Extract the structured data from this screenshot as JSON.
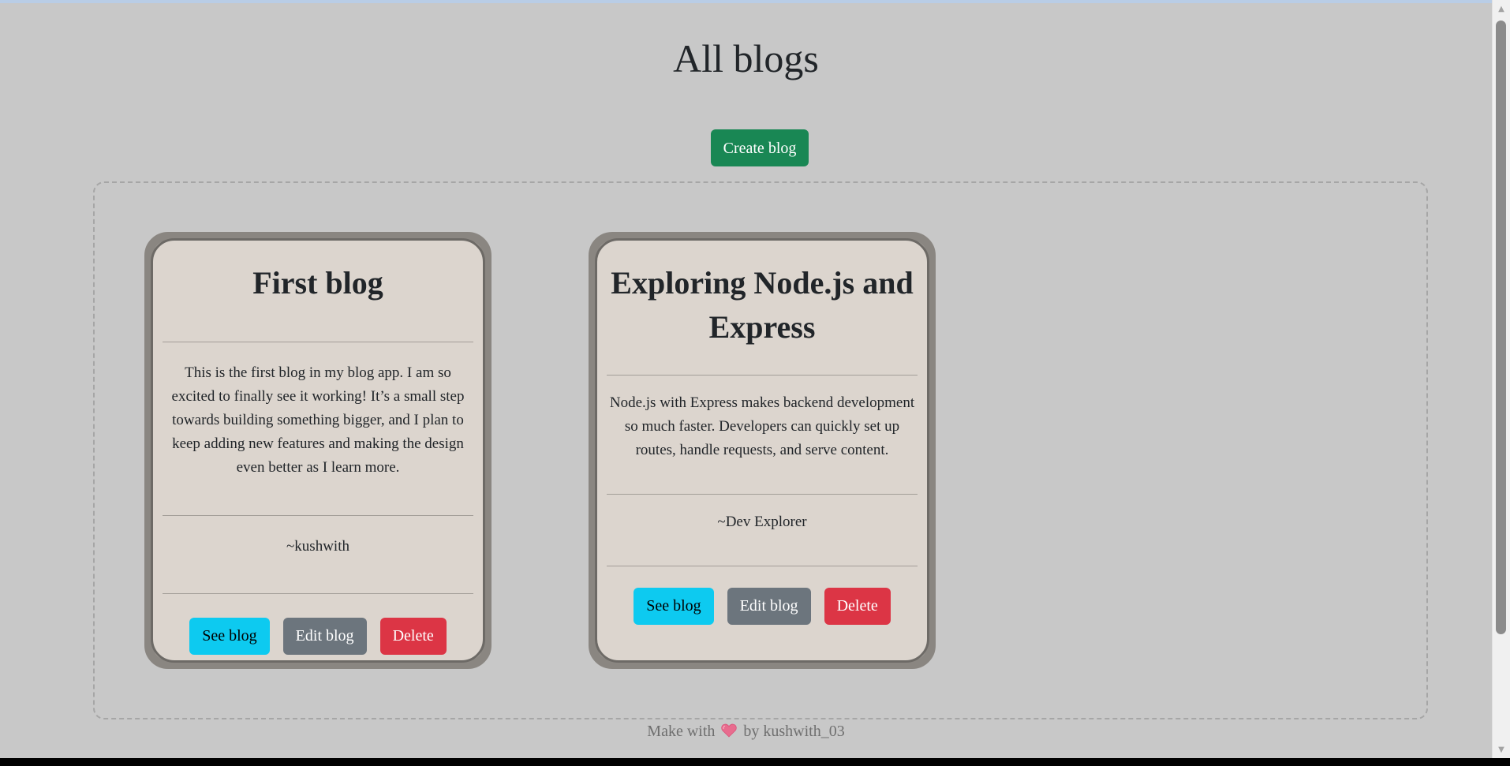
{
  "page": {
    "title": "All blogs",
    "create_button": "Create blog"
  },
  "blogs": [
    {
      "title": "First blog",
      "body": "This is the first blog in my blog app. I am so excited to finally see it working! It’s a small step towards building something bigger, and I plan to keep adding new features and making the design even better as I learn more.",
      "author": "~kushwith",
      "see_label": "See blog",
      "edit_label": "Edit blog",
      "delete_label": "Delete"
    },
    {
      "title": "Exploring Node.js and Express",
      "body": "Node.js with Express makes backend development so much faster. Developers can quickly set up routes, handle requests, and serve content.",
      "author": "~Dev Explorer",
      "see_label": "See blog",
      "edit_label": "Edit blog",
      "delete_label": "Delete"
    }
  ],
  "footer": {
    "prefix": "Make with",
    "heart_icon": "heart-icon",
    "suffix": "by kushwith_03"
  },
  "colors": {
    "background": "#c8c8c8",
    "create": "#198754",
    "see": "#0dcaf0",
    "edit": "#6c757d",
    "delete": "#dc3545",
    "card": "#dcd5ce",
    "card_border": "#8a8681"
  }
}
